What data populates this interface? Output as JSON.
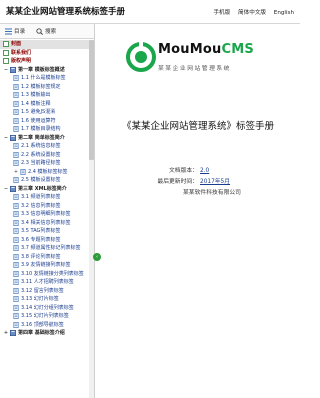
{
  "header": {
    "title": "某某企业网站管理系统标签手册",
    "links": [
      "手机版",
      "简体中文版",
      "English"
    ]
  },
  "sidebar": {
    "tabs": {
      "toc": "目录",
      "search": "搜索"
    },
    "toc": [
      {
        "type": "top",
        "label": "封面",
        "active": true
      },
      {
        "type": "top",
        "label": "联系我们"
      },
      {
        "type": "top",
        "label": "版权声明"
      },
      {
        "type": "chapter",
        "label": "第一章 模板标签概述",
        "toggle": "−"
      },
      {
        "type": "item",
        "label": "1.1 什么是模板标签"
      },
      {
        "type": "item",
        "label": "1.2 模板标签规定"
      },
      {
        "type": "item",
        "label": "1.3 模板输出"
      },
      {
        "type": "item",
        "label": "1.4 模板注释"
      },
      {
        "type": "item",
        "label": "1.5 避免JS混淆"
      },
      {
        "type": "item",
        "label": "1.6 使用运算符"
      },
      {
        "type": "item",
        "label": "1.7 模板目录结构"
      },
      {
        "type": "chapter",
        "label": "第二章 简单标签简介",
        "toggle": "−"
      },
      {
        "type": "item",
        "label": "2.1 系统信息标签"
      },
      {
        "type": "item",
        "label": "2.2 系统设置标签"
      },
      {
        "type": "item",
        "label": "2.3 当前路径标签"
      },
      {
        "type": "item",
        "label": "2.4 模板标签标签",
        "toggle": "+"
      },
      {
        "type": "item",
        "label": "2.5 模板设置标签"
      },
      {
        "type": "chapter",
        "label": "第三章 XML标签简介",
        "toggle": "−"
      },
      {
        "type": "item",
        "label": "3.1 频道列表标签"
      },
      {
        "type": "item",
        "label": "3.2 信息列表标签"
      },
      {
        "type": "item",
        "label": "3.3 信息明细列表标签"
      },
      {
        "type": "item",
        "label": "3.4 相关信息列表标签"
      },
      {
        "type": "item",
        "label": "3.5 TAG列表标签"
      },
      {
        "type": "item",
        "label": "3.6 专题列表标签"
      },
      {
        "type": "item",
        "label": "3.7 频道属性标记列表标签"
      },
      {
        "type": "item",
        "label": "3.8 评论列表标签"
      },
      {
        "type": "item",
        "label": "3.9 友情链接列表标签"
      },
      {
        "type": "item",
        "label": "3.10 友情链接分类列表标签"
      },
      {
        "type": "item",
        "label": "3.11 人才招聘列表标签"
      },
      {
        "type": "item",
        "label": "3.12 留言列表标签"
      },
      {
        "type": "item",
        "label": "3.13 幻灯片标签"
      },
      {
        "type": "item",
        "label": "3.14 幻灯分组列表标签"
      },
      {
        "type": "item",
        "label": "3.15 幻灯片列表标签"
      },
      {
        "type": "item",
        "label": "3.16 顶部导航标签"
      },
      {
        "type": "chapter",
        "label": "第四章 基础标签介绍",
        "toggle": "+"
      }
    ]
  },
  "main": {
    "logo_text_prefix": "MouMou",
    "logo_text_suffix": "CMS",
    "logo_subtitle": "某某企业网站管理系统",
    "doc_title": "《某某企业网站管理系统》标签手册",
    "version_label": "文档版本：",
    "version_value": "2.0",
    "updated_label": "最后更新时间：",
    "updated_value": "2017年5月",
    "company": "某某软件科技有限公司"
  },
  "colors": {
    "accent_green": "#1aa64a",
    "link_blue": "#1a3d8f",
    "top_item_red": "#8b0000"
  }
}
